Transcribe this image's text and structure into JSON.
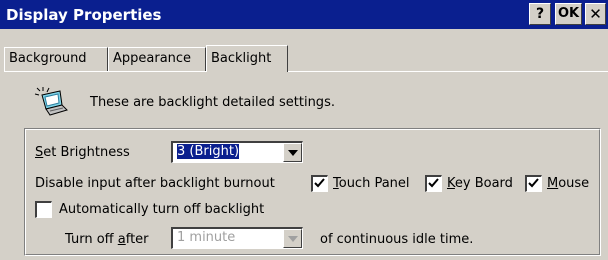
{
  "window": {
    "title": "Display Properties",
    "help_label": "?",
    "ok_label": "OK",
    "close_label": "✕"
  },
  "tabs": [
    {
      "label": "Background",
      "active": false
    },
    {
      "label": "Appearance",
      "active": false
    },
    {
      "label": "Backlight",
      "active": true
    }
  ],
  "intro": {
    "icon": "laptop-backlight-icon",
    "text": "These are backlight detailed settings."
  },
  "brightness": {
    "label_hotkey": "S",
    "label_rest": "et Brightness",
    "value": "3 (Bright)"
  },
  "disable_input": {
    "label": "Disable input after backlight burnout",
    "options": [
      {
        "hotkey": "T",
        "rest": "ouch Panel",
        "checked": true
      },
      {
        "hotkey": "K",
        "rest": "ey Board",
        "checked": true
      },
      {
        "hotkey": "M",
        "rest": "ouse",
        "checked": true
      }
    ]
  },
  "auto_off": {
    "label": "Automatically turn off backlight",
    "checked": false,
    "turn_off_prefix": "Turn off ",
    "turn_off_hotkey": "a",
    "turn_off_rest": "fter",
    "value": "1 minute",
    "suffix": "of continuous idle time."
  }
}
